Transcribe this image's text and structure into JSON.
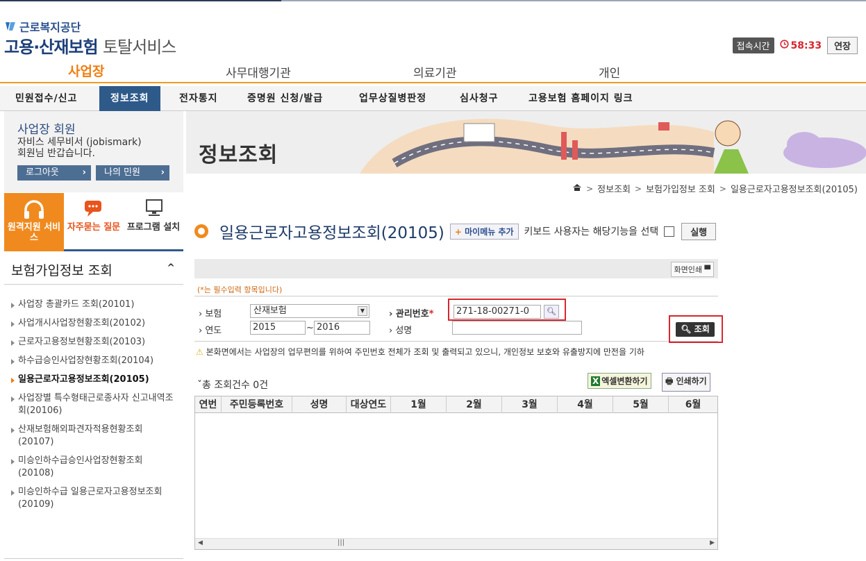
{
  "header": {
    "org_name": "근로복지공단",
    "service_main": "고용·산재보험",
    "service_sub": "토탈서비스",
    "session_label": "접속시간",
    "session_timer": "58:33",
    "extend_label": "연장"
  },
  "top_tabs": [
    {
      "label": "사업장",
      "active": true
    },
    {
      "label": "사무대행기관",
      "active": false
    },
    {
      "label": "의료기관",
      "active": false
    },
    {
      "label": "개인",
      "active": false
    }
  ],
  "gnb": [
    {
      "label": "민원접수/신고"
    },
    {
      "label": "정보조회",
      "active": true
    },
    {
      "label": "전자통지"
    },
    {
      "label": "증명원 신청/발급"
    },
    {
      "label": "업무상질병판정"
    },
    {
      "label": "심사청구"
    },
    {
      "label": "고용보험 홈페이지 링크"
    }
  ],
  "member": {
    "title": "사업장 회원",
    "line1": "자비스 세무비서 (jobismark)",
    "line2": "회원님 반갑습니다.",
    "logout_label": "로그아웃",
    "myminwon_label": "나의 민원"
  },
  "quick": {
    "remote_label": "원격지원 서비스",
    "faq_label": "자주묻는 질문",
    "program_label": "프로그램 설치"
  },
  "sidebar": {
    "title": "보험가입정보 조회",
    "items": [
      {
        "label": "사업장 총괄카드 조회(20101)"
      },
      {
        "label": "사업개시사업장현황조회(20102)"
      },
      {
        "label": "근로자고용정보현황조회(20103)"
      },
      {
        "label": "하수급승인사업장현황조회(20104)"
      },
      {
        "label": "일용근로자고용정보조회(20105)",
        "active": true
      },
      {
        "label": "사업장별 특수형태근로종사자 신고내역조회(20106)"
      },
      {
        "label": "산재보험해외파견자적용현황조회(20107)"
      },
      {
        "label": "미승인하수급승인사업장현황조회(20108)"
      },
      {
        "label": "미승인하수급 일용근로자고용정보조회(20109)"
      }
    ]
  },
  "banner": {
    "title": "정보조회"
  },
  "breadcrumb": [
    "정보조회",
    "보험가입정보 조회",
    "일용근로자고용정보조회(20105)"
  ],
  "page": {
    "title": "일용근로자고용정보조회(20105)",
    "mymenu_label": "마이메뉴 추가",
    "keyboard_text": "키보드 사용자는 해당기능을 선택",
    "run_label": "실행",
    "print_screen_label": "화면인쇄",
    "required_note": "(*는 필수입력 항목입니다)"
  },
  "form": {
    "insurance_label": "보험",
    "insurance_value": "산재보험",
    "mgmt_label": "관리번호",
    "mgmt_value": "271-18-00271-0",
    "year_label": "연도",
    "year_from": "2015",
    "year_to": "2016",
    "tilde": "~",
    "name_label": "성명",
    "search_label": "조회"
  },
  "warning": "본화면에서는 사업장의 업무편의를 위하여 주민번호 전체가 조회 및 출력되고 있으니, 개인정보 보호와 유출방지에 만전을 기하",
  "result": {
    "total_label": "총 조회건수 0건",
    "excel_label": "엑셀변환하기",
    "print_label": "인쇄하기",
    "columns": [
      "연번",
      "주민등록번호",
      "성명",
      "대상연도",
      "1월",
      "2월",
      "3월",
      "4월",
      "5월",
      "6월"
    ]
  },
  "colors": {
    "accent_orange": "#f07d10",
    "nav_blue": "#2e5a8a",
    "highlight_red": "#d8262f"
  }
}
